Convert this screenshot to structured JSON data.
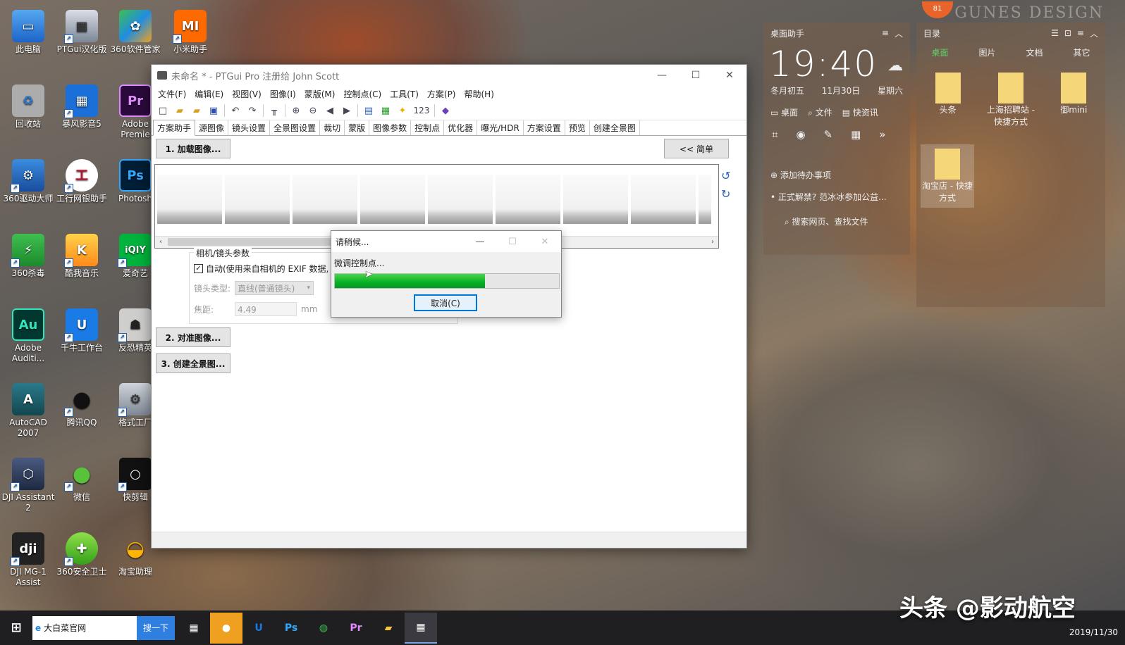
{
  "desktop": {
    "watermark_top": "GUNES DESIGN",
    "badge": "81",
    "icons": [
      {
        "label": "此电脑"
      },
      {
        "label": "PTGui汉化版"
      },
      {
        "label": "360软件管家"
      },
      {
        "label": "小米助手"
      },
      {
        "label": "回收站"
      },
      {
        "label": "暴风影音5"
      },
      {
        "label": "Adobe Premie"
      },
      {
        "label": "360驱动大师"
      },
      {
        "label": "工行网银助手"
      },
      {
        "label": "Photosh"
      },
      {
        "label": "360杀毒"
      },
      {
        "label": "酷我音乐"
      },
      {
        "label": "爱奇艺"
      },
      {
        "label": "Adobe Auditi..."
      },
      {
        "label": "千牛工作台"
      },
      {
        "label": "反恐精英"
      },
      {
        "label": "AutoCAD 2007"
      },
      {
        "label": "腾讯QQ"
      },
      {
        "label": "格式工厂"
      },
      {
        "label": "DJI Assistant 2"
      },
      {
        "label": "微信"
      },
      {
        "label": "快剪辑"
      },
      {
        "label": "DJI MG-1 Assist"
      },
      {
        "label": "360安全卫士"
      },
      {
        "label": "淘宝助理"
      }
    ]
  },
  "window": {
    "title": "未命名 * - PTGui Pro 注册给 John Scott",
    "controls": {
      "minimize": "—",
      "maximize": "☐",
      "close": "✕"
    },
    "menu": [
      "文件(F)",
      "编辑(E)",
      "视图(V)",
      "图像(I)",
      "蒙版(M)",
      "控制点(C)",
      "工具(T)",
      "方案(P)",
      "帮助(H)"
    ],
    "toolbar_number": "123",
    "tabs": [
      "方案助手",
      "源图像",
      "镜头设置",
      "全景图设置",
      "裁切",
      "蒙版",
      "图像参数",
      "控制点",
      "优化器",
      "曝光/HDR",
      "方案设置",
      "预览",
      "创建全景图"
    ],
    "buttons": {
      "load": "1. 加载图像...",
      "simple": "<< 简单",
      "align": "2. 对准图像...",
      "create": "3. 创建全景图..."
    },
    "camera_group": {
      "title": "相机/镜头参数",
      "auto_label": "自动(使用来自相机的 EXIF 数据,",
      "lens_type_label": "镜头类型:",
      "lens_type_value": "直线(普通镜头)",
      "focal_label": "焦距:",
      "focal_value": "4.49",
      "focal_unit": "mm"
    }
  },
  "dialog": {
    "title": "请稍候...",
    "message": "微调控制点...",
    "progress": 0.67,
    "cancel": "取消(C)"
  },
  "widget_left": {
    "header": "桌面助手",
    "time": "19:40",
    "lunar": "冬月初五",
    "date": "11月30日",
    "weekday": "星期六",
    "links": [
      "桌面",
      "文件",
      "快资讯"
    ],
    "todo": "添加待办事项",
    "news": "正式解禁? 范冰冰参加公益...",
    "search": "搜索网页、查找文件"
  },
  "widget_right": {
    "header": "目录",
    "tabs": [
      "桌面",
      "图片",
      "文档",
      "其它"
    ],
    "items": [
      {
        "label": "头条"
      },
      {
        "label": "上海招聘站 - 快捷方式"
      },
      {
        "label": "御mini"
      },
      {
        "label": "淘宝店 - 快捷方式"
      }
    ]
  },
  "taskbar": {
    "search_text": "大白菜官网",
    "search_button": "搜一下",
    "date": "2019/11/30"
  },
  "watermark": "头条 @影动航空",
  "colors": {
    "accent": "#0078d7",
    "progress": "#06b025",
    "taskbar": "#1f1f22"
  }
}
